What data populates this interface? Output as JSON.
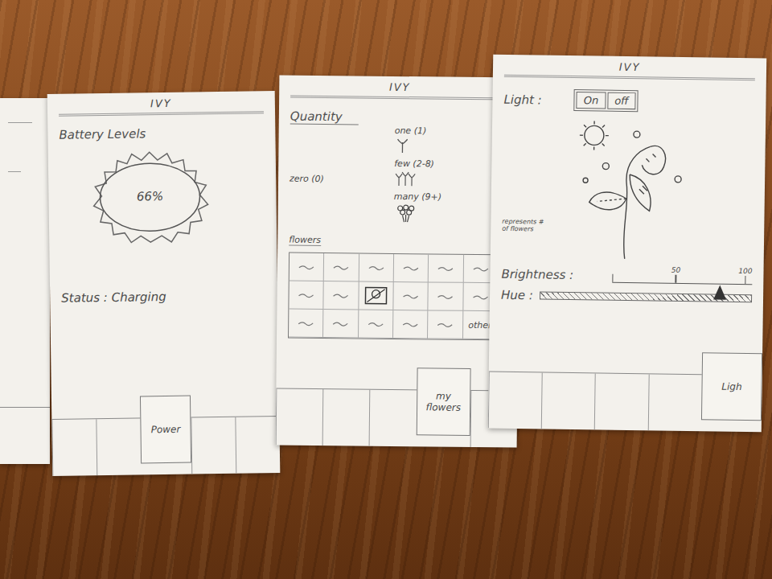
{
  "battery_sheet": {
    "title": "IVY",
    "heading": "Battery Levels",
    "reading": "66%",
    "status": "Status : Charging",
    "tabs": [
      {
        "label": "",
        "selected": false
      },
      {
        "label": "",
        "selected": false
      },
      {
        "label": "Power",
        "selected": true
      },
      {
        "label": "",
        "selected": false
      },
      {
        "label": "",
        "selected": false
      }
    ]
  },
  "quantity_sheet": {
    "title": "IVY",
    "heading": "Quantity",
    "options": [
      {
        "label": "zero (0)",
        "kind": "zero"
      },
      {
        "label": "one (1)",
        "kind": "one"
      },
      {
        "label": "few (2-8)",
        "kind": "few"
      },
      {
        "label": "many (9+)",
        "kind": "many"
      }
    ],
    "grid_label": "flowers",
    "cells": [
      {
        "label": "",
        "selected": false
      },
      {
        "label": "",
        "selected": false
      },
      {
        "label": "",
        "selected": false
      },
      {
        "label": "",
        "selected": false
      },
      {
        "label": "",
        "selected": false
      },
      {
        "label": "",
        "selected": false
      },
      {
        "label": "",
        "selected": false
      },
      {
        "label": "",
        "selected": false
      },
      {
        "label": "",
        "selected": true
      },
      {
        "label": "",
        "selected": false
      },
      {
        "label": "",
        "selected": false
      },
      {
        "label": "",
        "selected": false
      },
      {
        "label": "",
        "selected": false
      },
      {
        "label": "",
        "selected": false
      },
      {
        "label": "",
        "selected": false
      },
      {
        "label": "",
        "selected": false
      },
      {
        "label": "",
        "selected": false
      },
      {
        "label": "other",
        "selected": false
      }
    ],
    "tabs": [
      {
        "label": "",
        "selected": false
      },
      {
        "label": "",
        "selected": false
      },
      {
        "label": "",
        "selected": false
      },
      {
        "label": "my flowers",
        "selected": true
      },
      {
        "label": "",
        "selected": false
      }
    ]
  },
  "light_sheet": {
    "title": "IVY",
    "label": "Light :",
    "toggle": [
      "On",
      "off"
    ],
    "note": "represents # of flowers",
    "brightness": {
      "label": "Brightness :",
      "ticks": [
        "50",
        "100"
      ]
    },
    "hue": {
      "label": "Hue :",
      "level": 0.85
    },
    "tabs": [
      {
        "label": "",
        "selected": false
      },
      {
        "label": "",
        "selected": false
      },
      {
        "label": "",
        "selected": false
      },
      {
        "label": "",
        "selected": false
      },
      {
        "label": "Ligh",
        "selected": true
      }
    ]
  }
}
